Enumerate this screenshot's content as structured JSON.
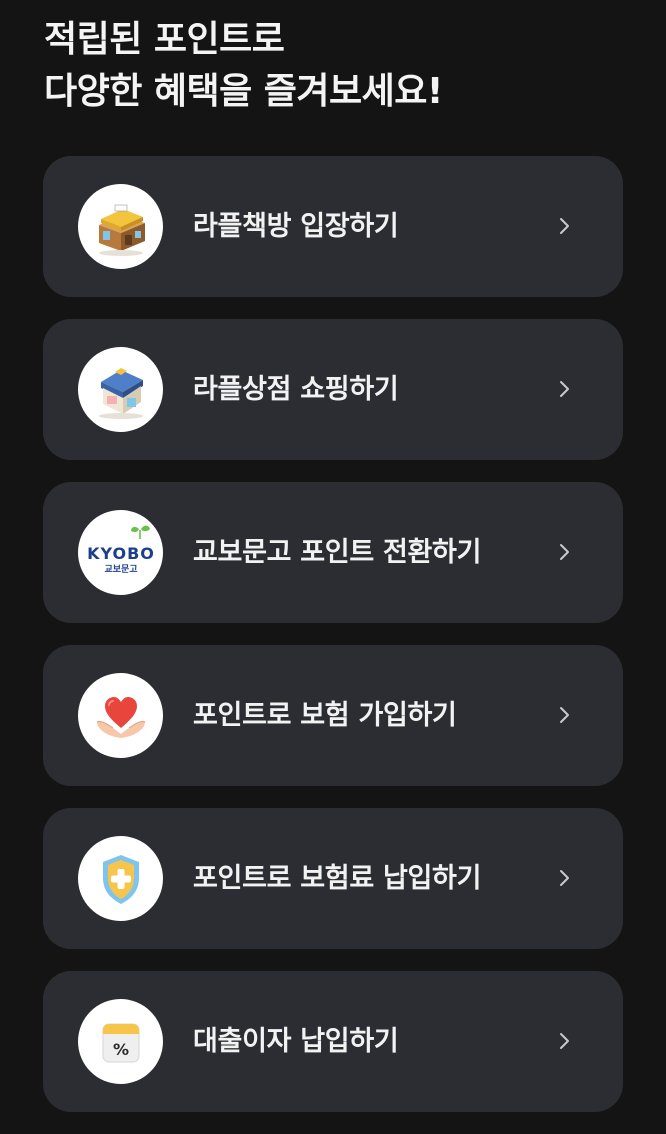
{
  "header": {
    "title_line1": "적립된 포인트로",
    "title_line2": "다양한 혜택을 즐겨보세요!"
  },
  "menu": [
    {
      "label": "라플책방 입장하기",
      "icon": "bookstore-icon"
    },
    {
      "label": "라플상점 쇼핑하기",
      "icon": "shop-icon"
    },
    {
      "label": "교보문고 포인트 전환하기",
      "icon": "kyobo-logo-icon",
      "logo_text": "KYOBO",
      "logo_subtext": "교보문고"
    },
    {
      "label": "포인트로 보험 가입하기",
      "icon": "heart-hands-icon"
    },
    {
      "label": "포인트로 보험료 납입하기",
      "icon": "shield-plus-icon"
    },
    {
      "label": "대출이자 납입하기",
      "icon": "percent-calendar-icon",
      "icon_text": "%"
    }
  ],
  "colors": {
    "background": "#141414",
    "card": "#2c2d32",
    "text": "#f2f2f3",
    "chevron": "#c9c9cc"
  }
}
